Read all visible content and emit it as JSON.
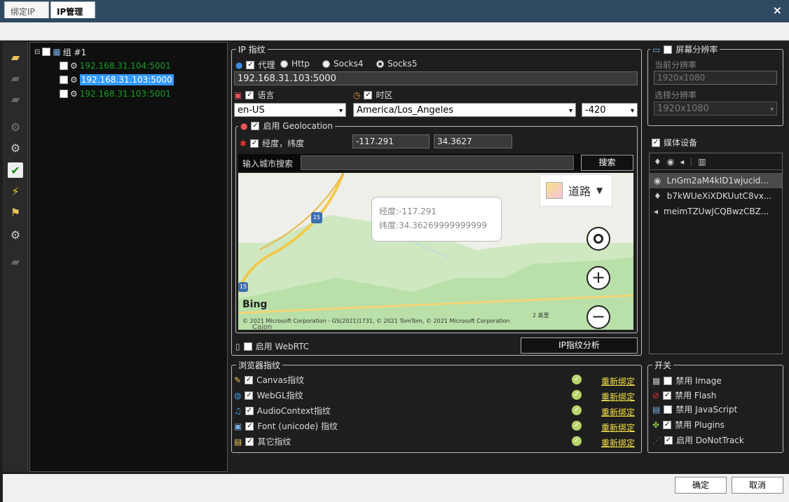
{
  "window": {
    "close": "×"
  },
  "tabs": [
    {
      "label": "绑定IP"
    },
    {
      "label": "IP管理"
    }
  ],
  "tree": {
    "group": "组 #1",
    "items": [
      {
        "label": "192.168.31.104:5001",
        "color": "#1a9c2a"
      },
      {
        "label": "192.168.31.103:5000",
        "color": "#ffffff",
        "selected": true
      },
      {
        "label": "192.168.31.103:5001",
        "color": "#1a9c2a"
      }
    ]
  },
  "ip_fp": {
    "title": "IP 指纹",
    "proxy_label": "代理",
    "proxy_types": [
      "Http",
      "Socks4",
      "Socks5"
    ],
    "proxy_selected": "Socks5",
    "proxy_value": "192.168.31.103:5000",
    "lang_label": "语言",
    "lang_value": "en-US",
    "tz_label": "时区",
    "tz_value": "America/Los_Angeles",
    "offset_value": "-420",
    "geo_title": "启用 Geolocation",
    "lnglat_label": "经度，纬度",
    "lng": "-117.291",
    "lat": "34.3627",
    "city_label": "输入城市搜索",
    "search_btn": "搜索",
    "map": {
      "road_label": "道路",
      "popup_lng": "经度:-117.291",
      "popup_lat": "纬度:34.36269999999999",
      "bing": "Bing",
      "copyright": "© 2021 Microsoft Corporation - GS(2021)1731, © 2021 TomTom, © 2021 Microsoft Corporation",
      "scale": "2 英里",
      "route_badge": "15",
      "route_badge2": "15",
      "town": "Cajon"
    },
    "webrtc_label": "启用 WebRTC",
    "analyze_btn": "IP指纹分析"
  },
  "screen": {
    "title": "屏幕分辨率",
    "current_label": "当前分辨率",
    "current_value": "1920x1080",
    "select_label": "选择分辨率",
    "select_value": "1920x1080"
  },
  "media": {
    "title": "媒体设备",
    "items": [
      {
        "label": "LnGm2aM4kID1wjucid...",
        "icon": "webcam-icon"
      },
      {
        "label": "b7kWUeXiXDKUutC8vx...",
        "icon": "microphone-icon"
      },
      {
        "label": "meimTZUwJCQBwzCBZ...",
        "icon": "speaker-icon"
      }
    ]
  },
  "browser_fp": {
    "title": "浏览器指纹",
    "items": [
      {
        "label": "Canvas指纹",
        "action": "重新绑定"
      },
      {
        "label": "WebGL指纹",
        "action": "重新绑定"
      },
      {
        "label": "AudioContext指纹",
        "action": "重新绑定"
      },
      {
        "label": "Font (unicode) 指纹",
        "action": "重新绑定"
      },
      {
        "label": "其它指纹",
        "action": "重新绑定"
      }
    ]
  },
  "switches": {
    "title": "开关",
    "items": [
      {
        "label": "禁用 Image",
        "checked": false
      },
      {
        "label": "禁用 Flash",
        "checked": true
      },
      {
        "label": "禁用 JavaScript",
        "checked": false
      },
      {
        "label": "禁用 Plugins",
        "checked": true
      },
      {
        "label": "启用 DoNotTrack",
        "checked": true
      }
    ]
  },
  "footer": {
    "ok": "确定",
    "cancel": "取消"
  }
}
